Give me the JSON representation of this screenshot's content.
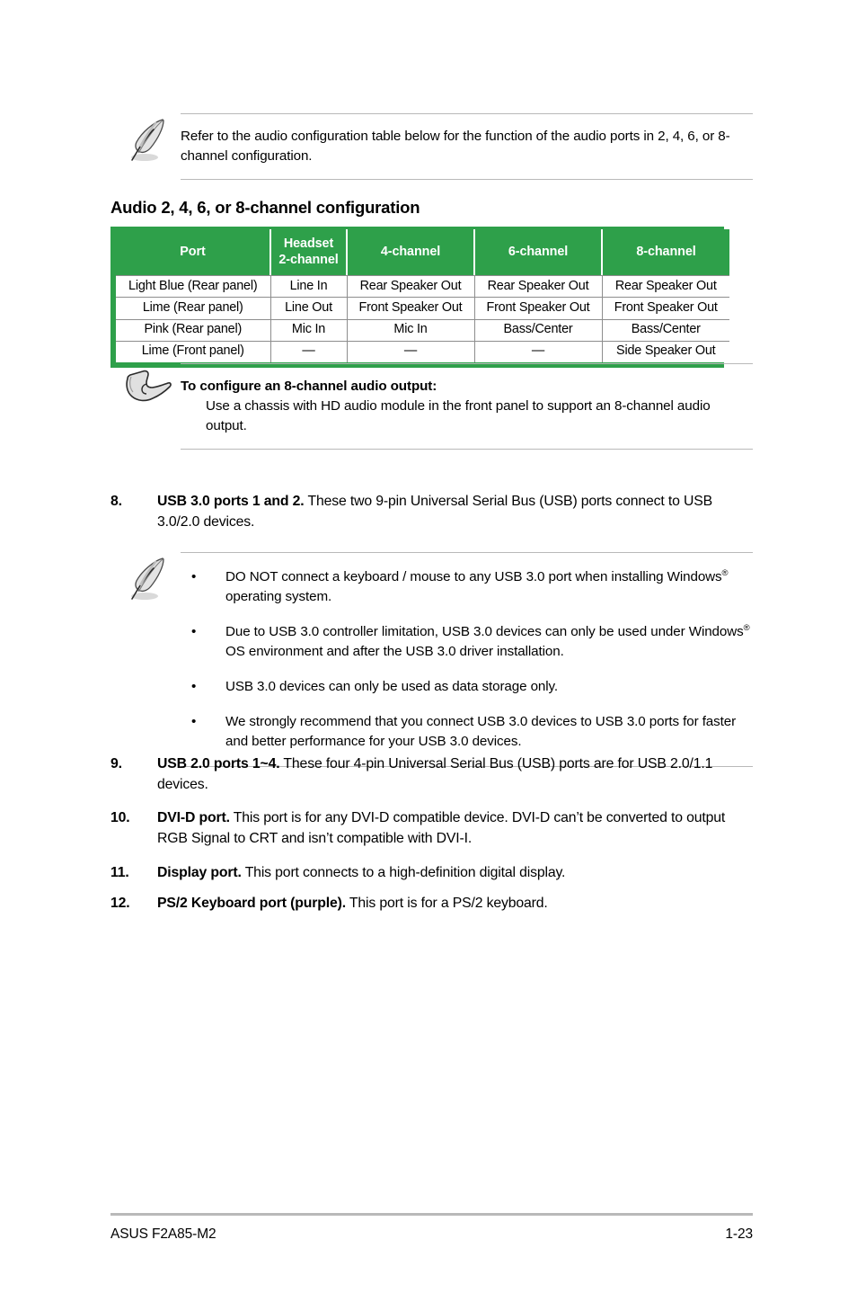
{
  "notes": {
    "audio_table_note": {
      "icon": "quill-pen-icon",
      "text": "Refer to the audio configuration table below for the function of the audio ports in 2, 4, 6, or 8-channel configuration."
    },
    "eight_channel_note": {
      "icon": "pointing-hand-icon",
      "heading": "To configure an 8-channel audio output:",
      "text": "Use a chassis with HD audio module in the front panel to support an 8-channel audio output."
    },
    "usb3_note": {
      "icon": "quill-pen-icon",
      "bullet_char": "•",
      "bullets": [
        {
          "part1": "DO NOT connect a keyboard / mouse to any USB 3.0 port when installing Windows",
          "sup": "®",
          "part2": " operating system."
        },
        {
          "part1": "Due to USB 3.0 controller limitation, USB 3.0 devices can only be used under Windows",
          "sup": "®",
          "part2": " OS environment and after the USB 3.0 driver installation."
        },
        {
          "part1": "USB 3.0 devices can only be used as data storage only.",
          "sup": "",
          "part2": ""
        },
        {
          "part1": "We strongly recommend that you connect USB 3.0 devices to USB 3.0 ports for faster and better performance for your USB 3.0 devices.",
          "sup": "",
          "part2": ""
        }
      ]
    }
  },
  "section": {
    "title": "Audio 2, 4, 6, or 8-channel configuration"
  },
  "audio_table": {
    "header_bg": "#2ea04a",
    "header_text_color": "#ffffff",
    "headers": [
      "Port",
      "Headset\n2-channel",
      "4-channel",
      "6-channel",
      "8-channel"
    ],
    "headers_flat": {
      "port": "Port",
      "headset_line1": "Headset",
      "headset_line2": "2-channel",
      "ch4": "4-channel",
      "ch6": "6-channel",
      "ch8": "8-channel"
    },
    "rows": [
      [
        "Light Blue (Rear panel)",
        "Line In",
        "Rear Speaker Out",
        "Rear Speaker Out",
        "Rear Speaker Out"
      ],
      [
        "Lime (Rear panel)",
        "Line Out",
        "Front Speaker Out",
        "Front Speaker Out",
        "Front Speaker Out"
      ],
      [
        "Pink (Rear panel)",
        "Mic In",
        "Mic In",
        "Bass/Center",
        "Bass/Center"
      ],
      [
        "Lime (Front panel)",
        "—",
        "—",
        "—",
        "Side Speaker Out"
      ]
    ]
  },
  "items": [
    {
      "number": "8.",
      "bold": "USB 3.0 ports 1 and 2.",
      "rest": " These two 9-pin Universal Serial Bus (USB) ports connect to USB 3.0/2.0 devices."
    },
    {
      "number": "9.",
      "bold": "USB 2.0 ports 1~4.",
      "rest": " These four 4-pin Universal Serial Bus (USB) ports are for USB 2.0/1.1 devices."
    },
    {
      "number": "10.",
      "bold": "DVI-D port.",
      "rest": " This port is for any DVI-D compatible device. DVI-D can’t be converted to output RGB Signal to CRT and isn’t compatible with DVI-I."
    },
    {
      "number": "11.",
      "bold": "Display port.",
      "rest": " This port connects to a high-definition digital display."
    },
    {
      "number": "12.",
      "bold": "PS/2 Keyboard port (purple).",
      "rest": " This port is for a PS/2 keyboard."
    }
  ],
  "footer": {
    "left": "ASUS F2A85-M2",
    "right": "1-23"
  }
}
